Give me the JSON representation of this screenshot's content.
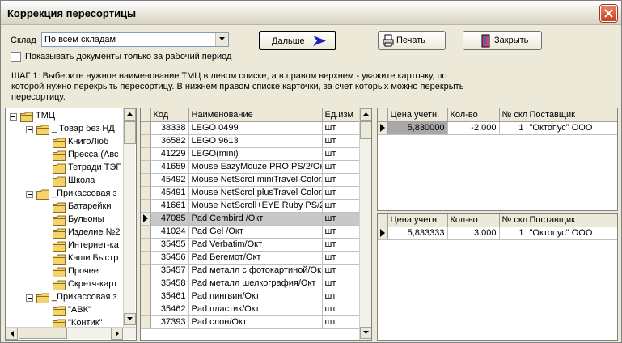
{
  "window": {
    "title": "Коррекция пересортицы"
  },
  "filter": {
    "warehouse_label": "Склад",
    "warehouse_value": "По всем складам",
    "work_period_label": "Показывать документы только за рабочий период",
    "work_period_checked": false
  },
  "buttons": {
    "next": "Дальше",
    "print": "Печать",
    "close": "Закрыть"
  },
  "step_text": "ШАГ 1:  Выберите нужное наименование ТМЦ в левом списке, а  в правом верхнем - укажите карточку, по которой нужно перекрыть пересортицу. В нижнем правом списке карточки, за счет которых можно перекрыть пересортицу.",
  "tree": {
    "root": "ТМЦ",
    "groups": [
      {
        "label": "_ Товар без НД",
        "children": [
          "КнигоЛюб",
          "Пресса (Авс",
          "Тетради ТЭГ",
          "Школа"
        ]
      },
      {
        "label": "_Прикассовая з",
        "children": [
          "Батарейки",
          "Бульоны",
          "Изделие №2",
          "Интернет-ка",
          "Каши Быстр",
          "Прочее",
          "Скретч-карт"
        ]
      },
      {
        "label": "_Прикассовая з",
        "children": [
          "\"АВК\"",
          "\"Контик\""
        ]
      }
    ]
  },
  "items": {
    "columns": [
      "Код",
      "Наименование",
      "Ед.изм"
    ],
    "selected_index": 8,
    "rows": [
      [
        "38338",
        "LEGO 0499",
        "шт"
      ],
      [
        "36582",
        "LEGO 9613",
        "шт"
      ],
      [
        "41229",
        "LEGO(mini)",
        "шт"
      ],
      [
        "41659",
        "Mouse EazyMouze PRO PS/2/Ок",
        "шт"
      ],
      [
        "45492",
        "Mouse NetScrol miniTravel Color/",
        "шт"
      ],
      [
        "45491",
        "Mouse NetScrol plusTravel Color/",
        "шт"
      ],
      [
        "41661",
        "Mouse NetScroll+EYE Ruby PS/2",
        "шт"
      ],
      [
        "47085",
        "Pad Cembird /Окт",
        "шт"
      ],
      [
        "41024",
        "Pad Gel /Окт",
        "шт"
      ],
      [
        "35455",
        "Pad Verbatim/Окт",
        "шт"
      ],
      [
        "35456",
        "Pad Бегемот/Окт",
        "шт"
      ],
      [
        "35457",
        "Pad металл с фотокартиной/Ок",
        "шт"
      ],
      [
        "35458",
        "Pad металл шелкография/Окт",
        "шт"
      ],
      [
        "35461",
        "Pad пингвин/Окт",
        "шт"
      ],
      [
        "35462",
        "Pad пластик/Окт",
        "шт"
      ],
      [
        "37393",
        "Pad слон/Окт",
        "шт"
      ]
    ]
  },
  "cards_top": {
    "columns": [
      "Цена учетн.",
      "Кол-во",
      "№ скл",
      "Поставщик"
    ],
    "rows": [
      [
        "5,830000",
        "-2,000",
        "1",
        "\"Октопус\" ООО"
      ]
    ]
  },
  "cards_bottom": {
    "columns": [
      "Цена учетн.",
      "Кол-во",
      "№ скл",
      "Поставщик"
    ],
    "rows": [
      [
        "5,833333",
        "3,000",
        "1",
        "\"Октопус\" ООО"
      ]
    ]
  },
  "icons": {
    "close": "close-x-icon",
    "next": "arrow-right-icon",
    "print": "printer-icon",
    "exit": "door-exit-icon",
    "folder": "folder-icon"
  },
  "colors": {
    "folder": "#f5d36b",
    "arrow": "#2020c0",
    "close_button": "#d2502f"
  }
}
